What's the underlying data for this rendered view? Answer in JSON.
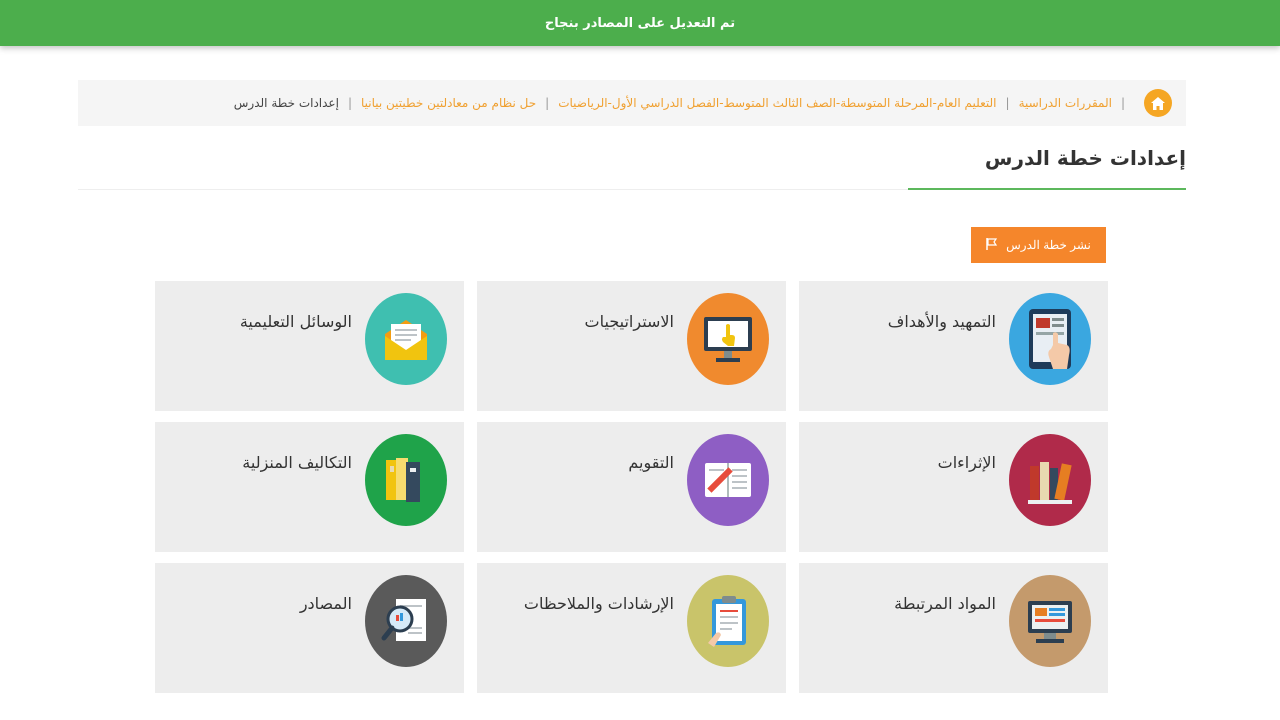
{
  "toast": {
    "message": "تم التعديل على المصادر بنجاح"
  },
  "breadcrumb": {
    "items": [
      "المقررات الدراسية",
      "التعليم العام-المرحلة المتوسطة-الصف الثالث المتوسط-الفصل الدراسي الأول-الرياضيات",
      "حل نظام من معادلتين خطيتين بيانيا",
      "إعدادات خطة الدرس"
    ]
  },
  "page": {
    "title": "إعدادات خطة الدرس",
    "publish_label": "نشر خطة الدرس"
  },
  "cards": [
    {
      "label": "التمهيد والأهداف",
      "icon": "tablet-hand-icon",
      "color": "#3aa7e0"
    },
    {
      "label": "الاستراتيجيات",
      "icon": "monitor-pointer-icon",
      "color": "#f08a2e"
    },
    {
      "label": "الوسائل التعليمية",
      "icon": "envelope-icon",
      "color": "#3fbfb0"
    },
    {
      "label": "الإثراءات",
      "icon": "books-icon",
      "color": "#b02a4a"
    },
    {
      "label": "التقويم",
      "icon": "notebook-pencil-icon",
      "color": "#8e5ec4"
    },
    {
      "label": "التكاليف المنزلية",
      "icon": "binders-icon",
      "color": "#1fa34a"
    },
    {
      "label": "المواد المرتبطة",
      "icon": "computer-icon",
      "color": "#c49a6c"
    },
    {
      "label": "الإرشادات والملاحظات",
      "icon": "clipboard-icon",
      "color": "#c9c46a"
    },
    {
      "label": "المصادر",
      "icon": "magnifier-document-icon",
      "color": "#5a5a5a"
    }
  ],
  "colors": {
    "toast": "#4cae4c",
    "accent": "#f5862b",
    "breadcrumb_link": "#f0a030"
  }
}
